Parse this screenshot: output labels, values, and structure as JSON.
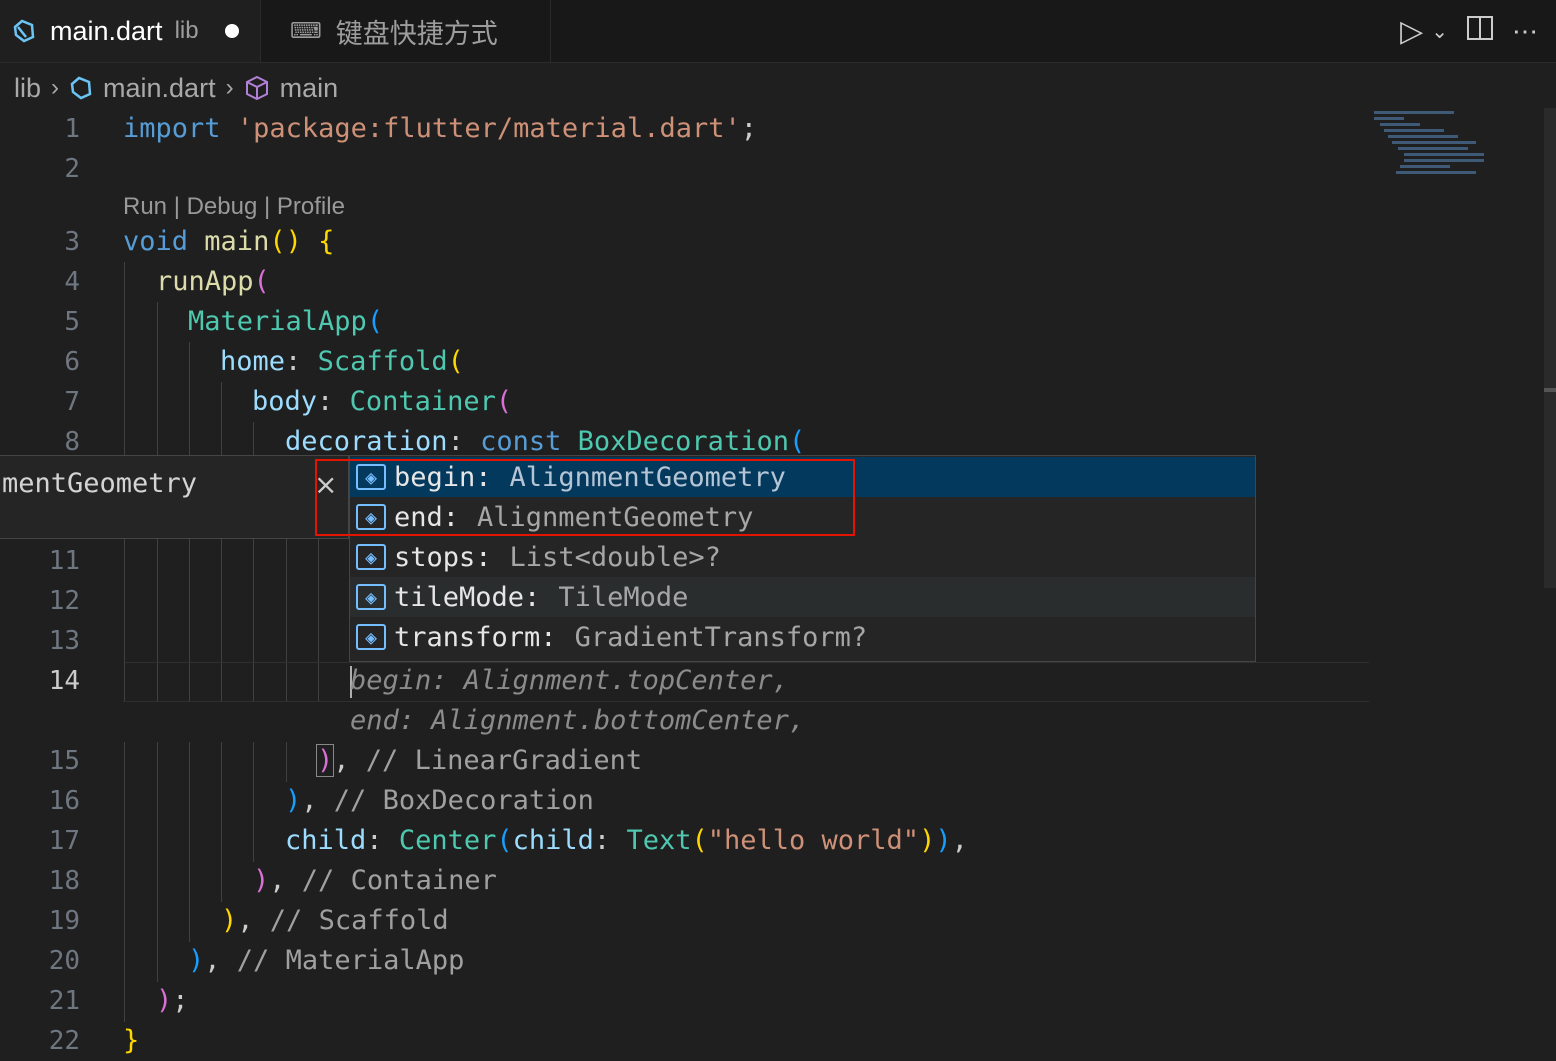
{
  "tabs": [
    {
      "label": "main.dart",
      "desc": "lib",
      "modified": true
    },
    {
      "label": "键盘快捷方式"
    }
  ],
  "breadcrumb": [
    "lib",
    "main.dart",
    "main"
  ],
  "codelens": "Run | Debug | Profile",
  "lines": {
    "n1": "1",
    "n2": "2",
    "n3": "3",
    "n4": "4",
    "n5": "5",
    "n6": "6",
    "n7": "7",
    "n8": "8",
    "n11": "11",
    "n12": "12",
    "n13": "13",
    "n14": "14",
    "n15": "15",
    "n16": "16",
    "n17": "17",
    "n18": "18",
    "n19": "19",
    "n20": "20",
    "n21": "21",
    "n22": "22"
  },
  "code": {
    "l1_kw": "import",
    "l1_str": "'package:flutter/material.dart'",
    "l1_end": ";",
    "l3_kw": "void",
    "l3_fn": "main",
    "l3_p": "()",
    "l3_b": "{",
    "l4_fn": "runApp",
    "l4_p": "(",
    "l5_cls": "MaterialApp",
    "l5_p": "(",
    "l6_prop": "home",
    "l6_c": ":",
    "l6_cls": "Scaffold",
    "l6_p": "(",
    "l7_prop": "body",
    "l7_c": ":",
    "l7_cls": "Container",
    "l7_p": "(",
    "l8_prop": "decoration",
    "l8_c": ":",
    "l8_kw": "const",
    "l8_cls": "BoxDecoration",
    "l8_p": "(",
    "ghost14": "begin: Alignment.topCenter,",
    "ghost14b": "end: Alignment.bottomCenter,",
    "l15_p": ")",
    "l15_cm": "// LinearGradient",
    "l15_c": ",",
    "l16_p": ")",
    "l16_c": ",",
    "l16_cm": "// BoxDecoration",
    "l17_prop": "child",
    "l17_c": ":",
    "l17_cls": "Center",
    "l17_p1": "(",
    "l17_prop2": "child",
    "l17_c2": ":",
    "l17_cls2": "Text",
    "l17_p2": "(",
    "l17_str": "\"hello world\"",
    "l17_p3": ")",
    "l17_p4": ")",
    "l17_end": ",",
    "l18_p": ")",
    "l18_c": ",",
    "l18_cm": "// Container",
    "l19_p": ")",
    "l19_c": ",",
    "l19_cm": "// Scaffold",
    "l20_p": ")",
    "l20_c": ",",
    "l20_cm": "// MaterialApp",
    "l21_p": ")",
    "l21_c": ";",
    "l22_b": "}"
  },
  "hover_detail": "mentGeometry",
  "suggestions": [
    {
      "label": "begin:",
      "type": "AlignmentGeometry"
    },
    {
      "label": "end:",
      "type": "AlignmentGeometry"
    },
    {
      "label": "stops:",
      "type": "List<double>?"
    },
    {
      "label": "tileMode:",
      "type": "TileMode"
    },
    {
      "label": "transform:",
      "type": "GradientTransform?"
    }
  ],
  "colors": {
    "accent": "#04395e",
    "highlight_box": "#e51400"
  }
}
